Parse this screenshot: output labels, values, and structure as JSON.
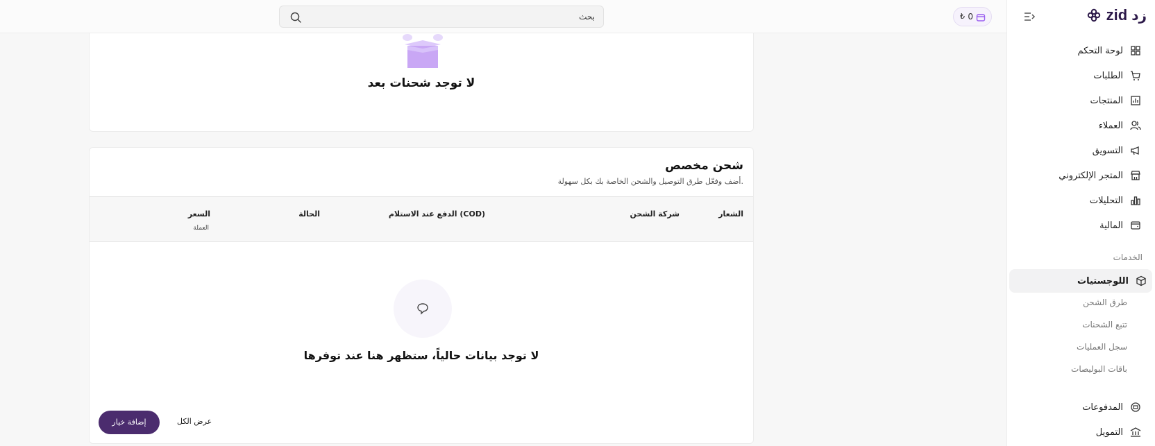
{
  "topbar": {
    "search_placeholder": "بحث",
    "wallet_value": "0",
    "wallet_currency": "₺"
  },
  "sidebar": {
    "logo_en": "zid",
    "logo_ar": "زد",
    "items": [
      {
        "label": "لوحة التحكم",
        "icon": "dashboard-icon"
      },
      {
        "label": "الطلبات",
        "icon": "cart-icon"
      },
      {
        "label": "المنتجات",
        "icon": "products-icon"
      },
      {
        "label": "العملاء",
        "icon": "users-icon"
      },
      {
        "label": "التسويق",
        "icon": "megaphone-icon"
      },
      {
        "label": "المتجر الإلكتروني",
        "icon": "store-icon"
      },
      {
        "label": "التحليلات",
        "icon": "analytics-icon"
      },
      {
        "label": "المالية",
        "icon": "wallet-icon"
      }
    ],
    "section_title": "الخدمات",
    "logistics": {
      "label": "اللوجستيات",
      "icon": "box-icon"
    },
    "sub_items": [
      "طرق الشحن",
      "تتبع الشحنات",
      "سجل العمليات",
      "باقات البوليصات"
    ],
    "payments": {
      "label": "المدفوعات",
      "icon": "payments-icon"
    },
    "financing": {
      "label": "التمويل",
      "icon": "bank-icon"
    }
  },
  "shipments_card": {
    "empty_text": "لا توجد شحنات بعد"
  },
  "custom_shipping": {
    "title": "شحن مخصص",
    "subtitle": "أضف وفعّل طرق التوصيل والشحن الخاصة بك بكل سهولة.",
    "columns": {
      "logo": "الشعار",
      "company": "شركة الشحن",
      "cod": "الدفع عند الاستلام (COD)",
      "status": "الحالة",
      "price": "السعر",
      "price_sub": "العملة"
    },
    "empty_text": "لا توجد بيانات حالياً، ستظهر هنا عند توفرها",
    "add_button": "إضافة خيار",
    "view_all": "عرض الكل"
  },
  "colors": {
    "accent": "#4b2c6e",
    "illustration": "#c9a7f5"
  }
}
